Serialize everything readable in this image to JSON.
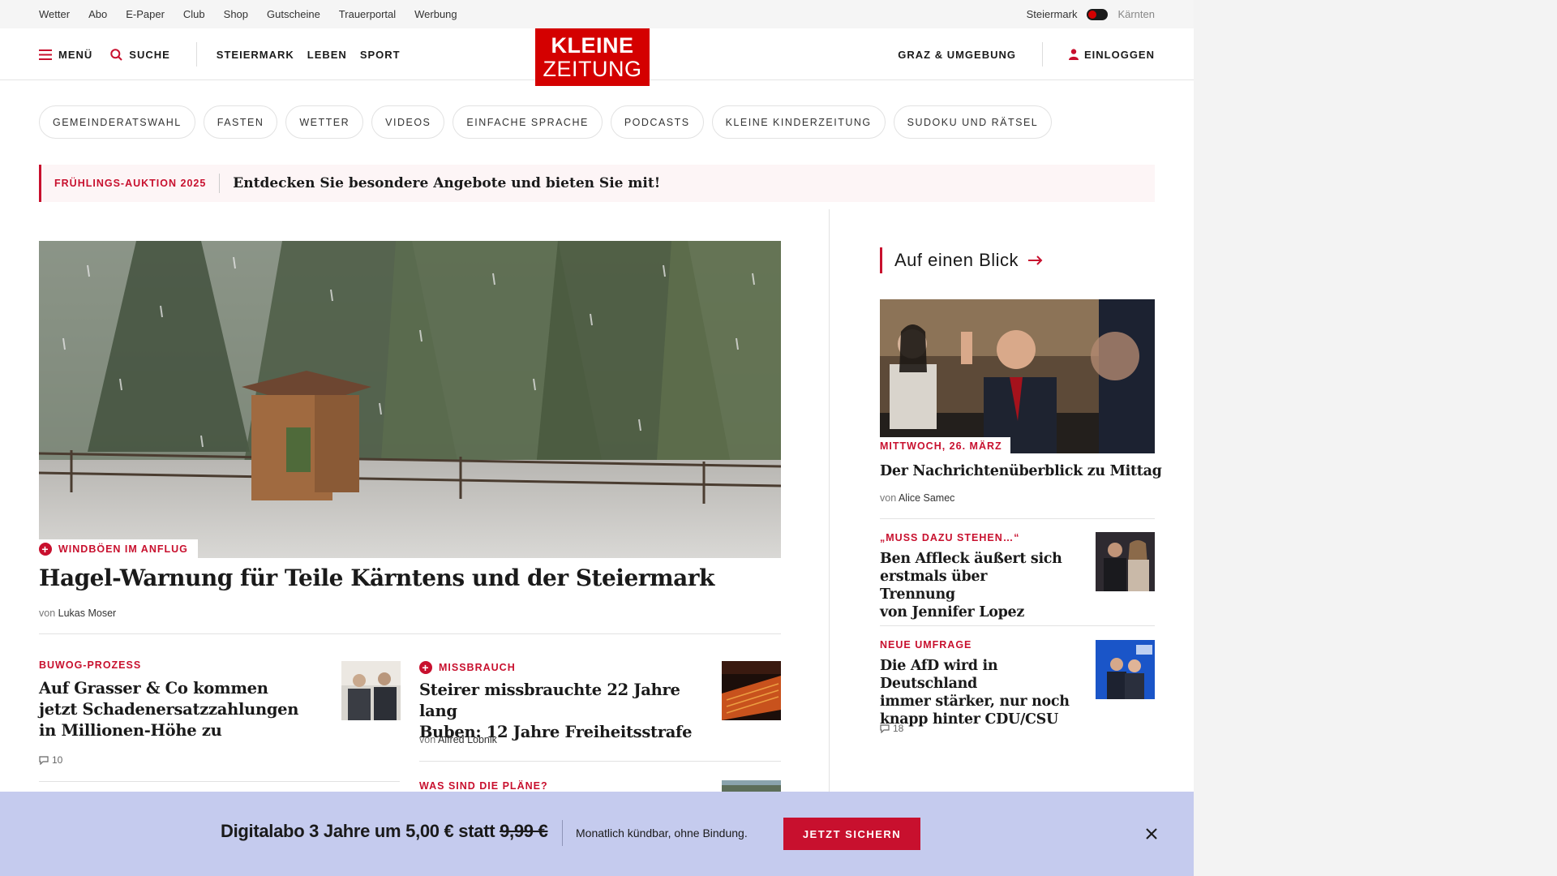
{
  "utility": {
    "links": [
      "Wetter",
      "Abo",
      "E-Paper",
      "Club",
      "Shop",
      "Gutscheine",
      "Trauerportal",
      "Werbung"
    ],
    "region_active": "Steiermark",
    "region_inactive": "Kärnten"
  },
  "header": {
    "menu_label": "MENÜ",
    "search_label": "SUCHE",
    "nav": [
      "STEIERMARK",
      "LEBEN",
      "SPORT"
    ],
    "logo_line1": "KLEINE",
    "logo_line2": "ZEITUNG",
    "city": "GRAZ & UMGEBUNG",
    "login_label": "EINLOGGEN"
  },
  "pills": [
    "GEMEINDERATSWAHL",
    "FASTEN",
    "WETTER",
    "VIDEOS",
    "EINFACHE SPRACHE",
    "PODCASTS",
    "KLEINE KINDERZEITUNG",
    "SUDOKU UND RÄTSEL"
  ],
  "promo": {
    "tag": "FRÜHLINGS-AUKTION 2025",
    "message": "Entdecken Sie besondere Angebote und bieten Sie mit!"
  },
  "hero": {
    "kicker": "WINDBÖEN IM ANFLUG",
    "title": "Hagel-Warnung für Teile Kärntens und der Steiermark",
    "by_prefix": "von",
    "author": "Lukas Moser"
  },
  "articles": [
    {
      "kicker": "BUWOG-PROZESS",
      "title_lines": [
        "Auf Grasser & Co kommen",
        "jetzt Schadenersatzzahlungen",
        "in Millionen-Höhe zu"
      ],
      "comments": "10"
    },
    {
      "kicker": "MISSBRAUCH",
      "title_lines": [
        "Steirer missbrauchte 22 Jahre lang",
        "Buben: 12 Jahre Freiheitsstrafe"
      ],
      "by_prefix": "von",
      "author": "Alfred Lobnik"
    },
    {
      "kicker": "WAS SIND DIE PLÄNE?"
    }
  ],
  "sidebar": {
    "heading": "Auf einen Blick",
    "lead": {
      "date": "MITTWOCH, 26. MÄRZ",
      "title": "Der Nachrichtenüberblick zu Mittag",
      "by_prefix": "von",
      "author": "Alice Samec"
    },
    "items": [
      {
        "kicker": "„MUSS DAZU STEHEN…“",
        "title_lines": [
          "Ben Affleck äußert sich",
          "erstmals über Trennung",
          "von Jennifer Lopez"
        ]
      },
      {
        "kicker": "NEUE UMFRAGE",
        "title_lines": [
          "Die AfD wird in Deutschland",
          "immer stärker, nur noch",
          "knapp hinter CDU/CSU"
        ],
        "comments": "18"
      }
    ]
  },
  "abo": {
    "offer": "Digitalabo 3 Jahre um 5,00 € statt",
    "old_price": "9,99 €",
    "note": "Monatlich kündbar, ohne Bindung.",
    "cta": "JETZT SICHERN"
  },
  "colors": {
    "brand_red": "#d40000",
    "accent_red": "#c8102e",
    "abo_bar": "#c5cbee"
  }
}
